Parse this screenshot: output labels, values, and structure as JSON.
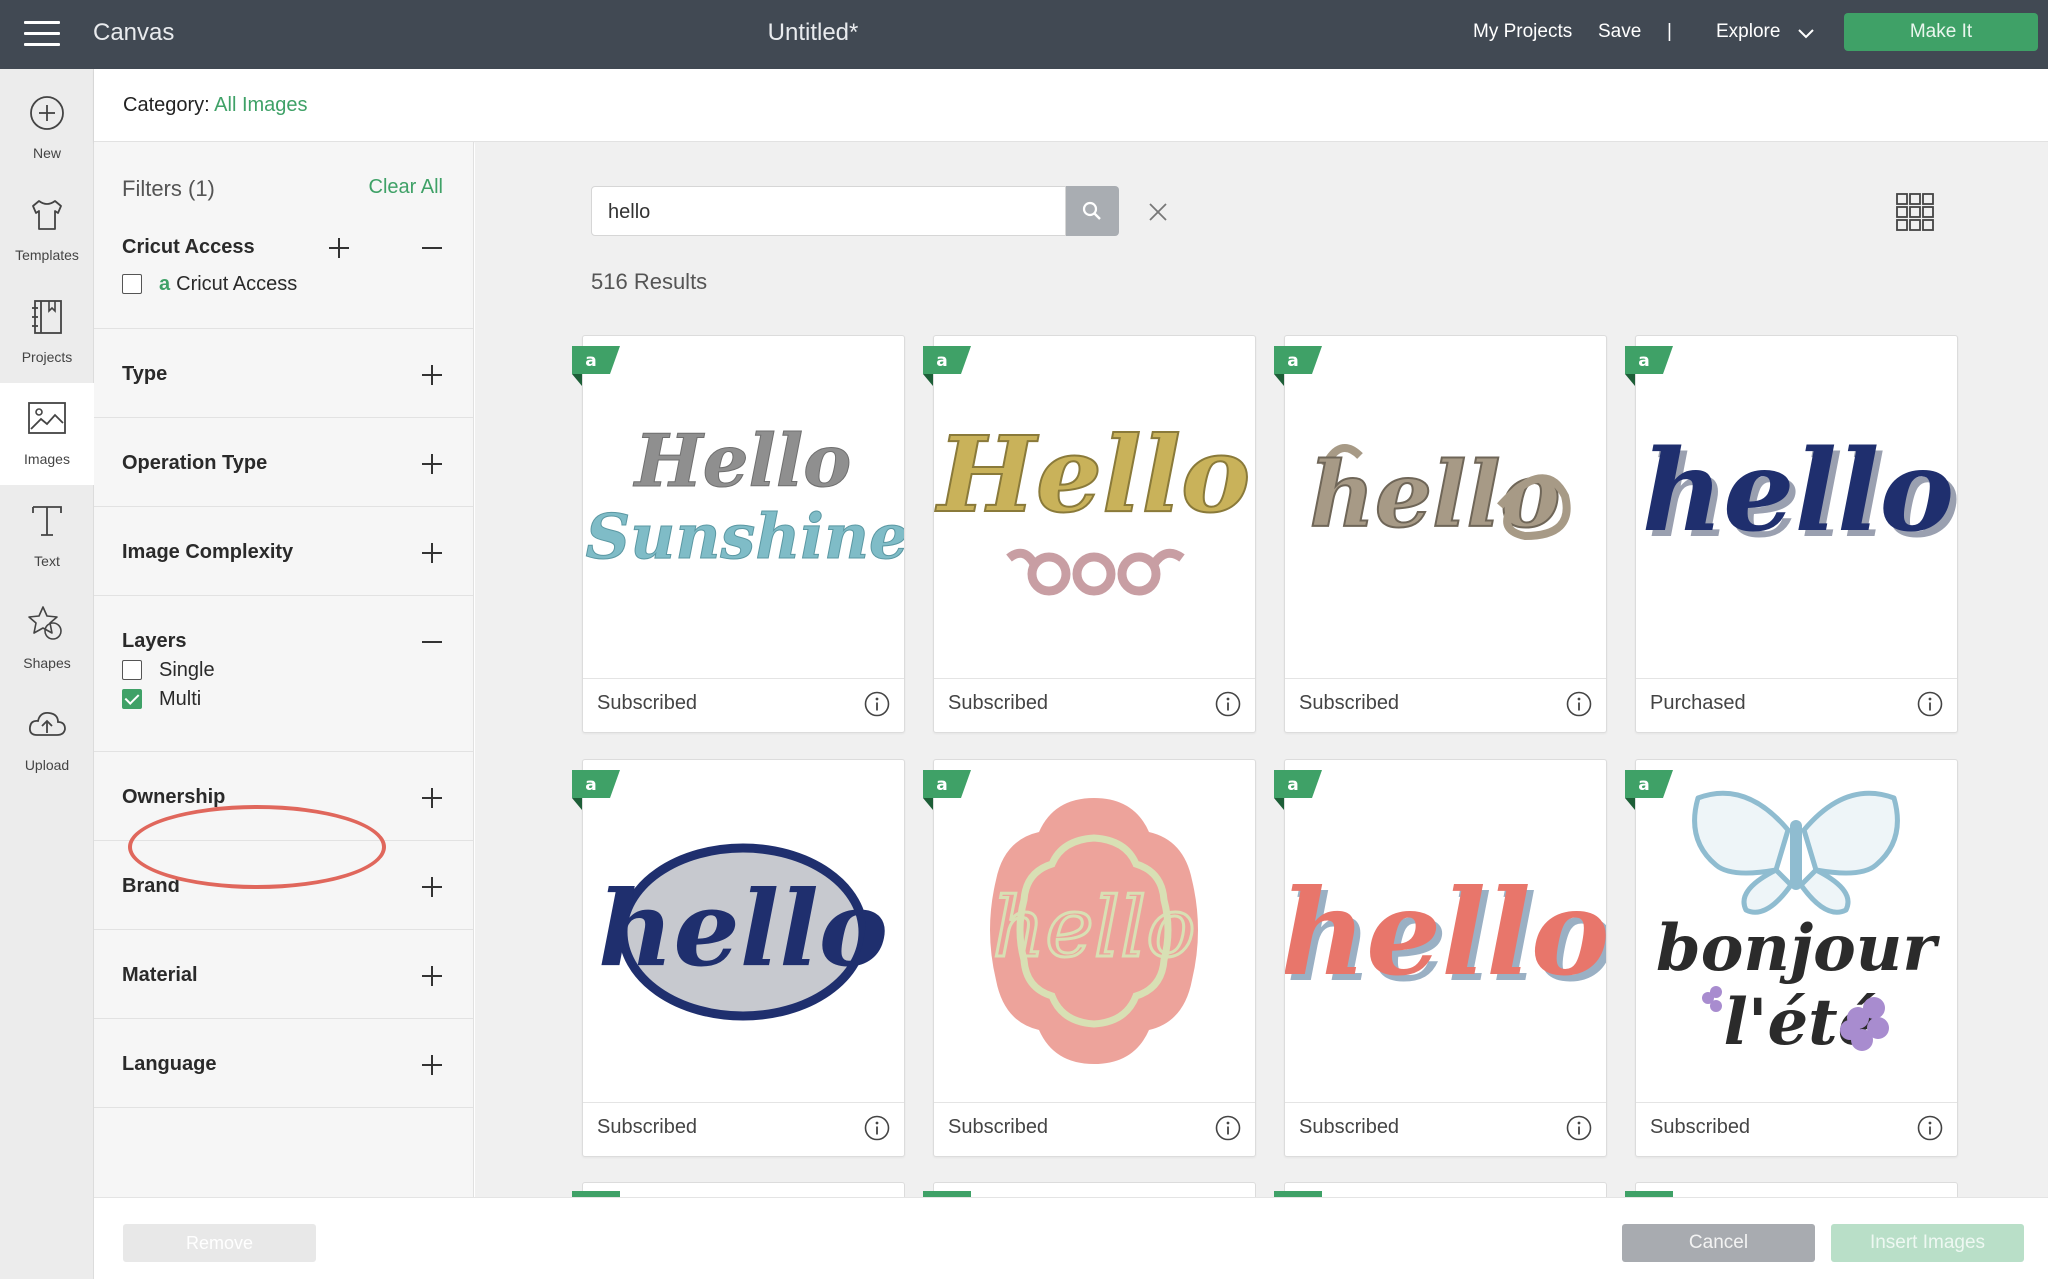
{
  "topbar": {
    "app_name": "Canvas",
    "document_title": "Untitled*",
    "my_projects": "My Projects",
    "save": "Save",
    "separator": "|",
    "explore": "Explore",
    "make_it": "Make It"
  },
  "rail": {
    "items": [
      {
        "label": "New",
        "icon": "plus-circle-icon"
      },
      {
        "label": "Templates",
        "icon": "tshirt-icon"
      },
      {
        "label": "Projects",
        "icon": "notebook-icon"
      },
      {
        "label": "Images",
        "icon": "image-icon",
        "active": true
      },
      {
        "label": "Text",
        "icon": "text-t-icon"
      },
      {
        "label": "Shapes",
        "icon": "shapes-icon"
      },
      {
        "label": "Upload",
        "icon": "upload-cloud-icon"
      }
    ]
  },
  "category": {
    "label": "Category:",
    "value": "All Images"
  },
  "filters": {
    "title": "Filters (1)",
    "clear_all": "Clear All",
    "sections": {
      "cricut_access": {
        "title": "Cricut Access",
        "option": "Cricut Access",
        "badge": "a",
        "checked": false
      },
      "type": {
        "title": "Type"
      },
      "operation_type": {
        "title": "Operation Type"
      },
      "image_complexity": {
        "title": "Image Complexity"
      },
      "layers": {
        "title": "Layers",
        "options": [
          {
            "label": "Single",
            "checked": false
          },
          {
            "label": "Multi",
            "checked": true
          }
        ]
      },
      "ownership": {
        "title": "Ownership"
      },
      "brand": {
        "title": "Brand"
      },
      "material": {
        "title": "Material"
      },
      "language": {
        "title": "Language"
      }
    }
  },
  "search": {
    "value": "hello",
    "results": "516 Results"
  },
  "cards": [
    {
      "status": "Subscribed",
      "art": "hello-sunshine"
    },
    {
      "status": "Subscribed",
      "art": "hello-gold-script"
    },
    {
      "status": "Subscribed",
      "art": "hello-tan-script"
    },
    {
      "status": "Purchased",
      "art": "hello-navy-script"
    },
    {
      "status": "Subscribed",
      "art": "hello-oval"
    },
    {
      "status": "Subscribed",
      "art": "hello-pink-label"
    },
    {
      "status": "Subscribed",
      "art": "hello-coral"
    },
    {
      "status": "Subscribed",
      "art": "bonjour-lete-butterfly"
    }
  ],
  "art_text": {
    "hello": "hello",
    "hello_cap": "Hello",
    "sunshine": "Sunshine",
    "bonjour": "bonjour",
    "lete": "l'été"
  },
  "footer": {
    "remove": "Remove",
    "cancel": "Cancel",
    "insert": "Insert Images"
  },
  "colors": {
    "accent_green": "#3fa167",
    "topbar": "#414953",
    "highlight_ring": "#e0675c"
  }
}
